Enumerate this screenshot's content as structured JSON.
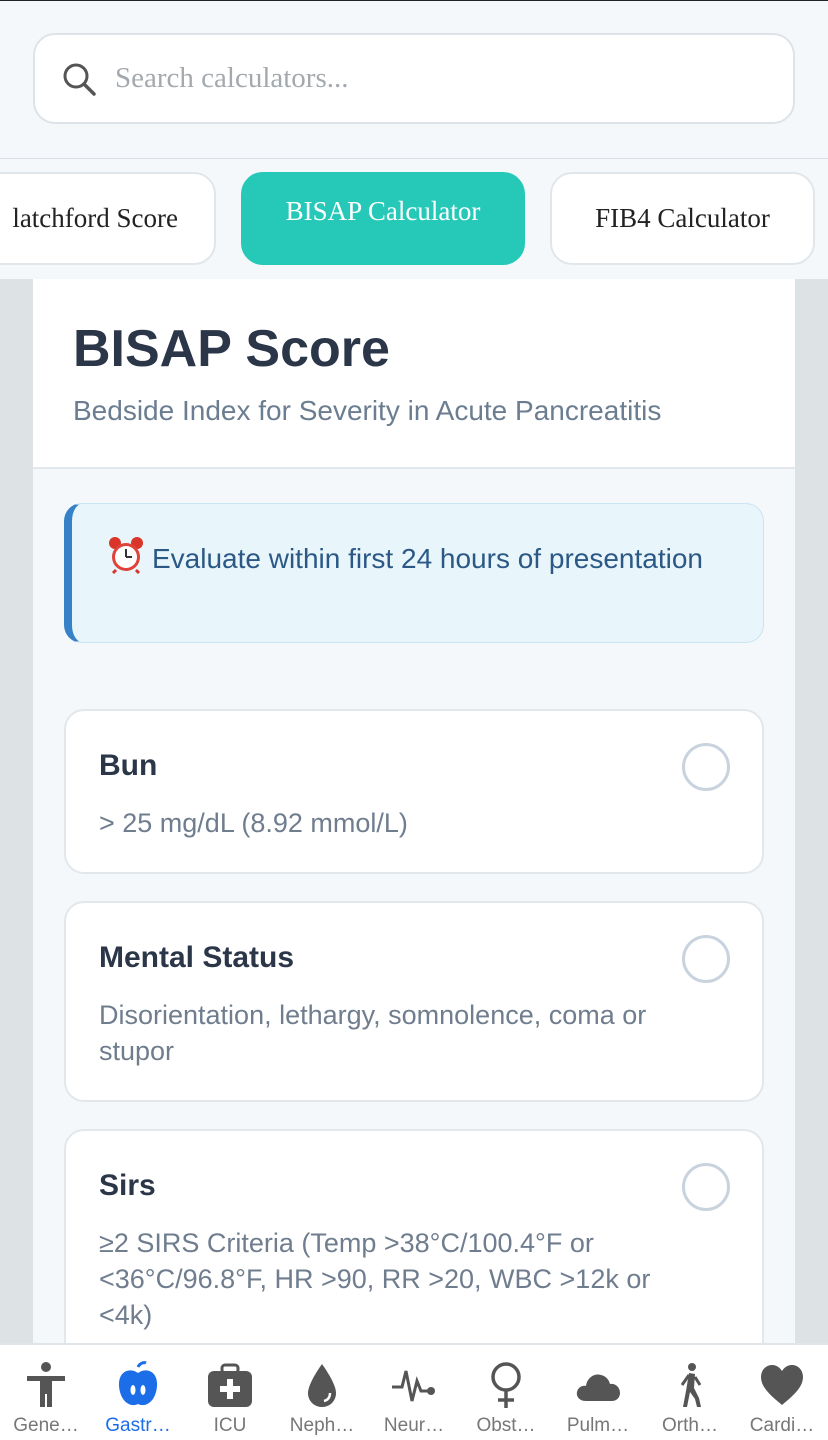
{
  "search": {
    "placeholder": "Search calculators..."
  },
  "calculator_tabs": [
    {
      "label": "Glatchford Score",
      "visible_label": "latchford Score",
      "active": false
    },
    {
      "label": "BISAP Calculator",
      "active": true
    },
    {
      "label": "FIB4 Calculator",
      "active": false
    }
  ],
  "calculator": {
    "title": "BISAP Score",
    "subtitle": "Bedside Index for Severity in Acute Pancreatitis",
    "notice": "Evaluate within first 24 hours of presentation",
    "criteria": [
      {
        "label": "Bun",
        "description": "> 25 mg/dL (8.92 mmol/L)",
        "checked": false
      },
      {
        "label": "Mental Status",
        "description": "Disorientation, lethargy, somnolence, coma or stupor",
        "checked": false
      },
      {
        "label": "Sirs",
        "description": "≥2 SIRS Criteria (Temp >38°C/100.4°F or <36°C/96.8°F, HR >90, RR >20, WBC >12k or <4k)",
        "checked": false
      }
    ]
  },
  "bottom_nav": [
    {
      "label": "Gene…",
      "icon": "person-icon",
      "active": false
    },
    {
      "label": "Gastr…",
      "icon": "stomach-icon",
      "active": true
    },
    {
      "label": "ICU",
      "icon": "medkit-icon",
      "active": false
    },
    {
      "label": "Neph…",
      "icon": "drop-icon",
      "active": false
    },
    {
      "label": "Neur…",
      "icon": "pulse-icon",
      "active": false
    },
    {
      "label": "Obst…",
      "icon": "female-icon",
      "active": false
    },
    {
      "label": "Pulm…",
      "icon": "cloud-icon",
      "active": false
    },
    {
      "label": "Orth…",
      "icon": "walking-icon",
      "active": false
    },
    {
      "label": "Cardi…",
      "icon": "heart-icon",
      "active": false
    }
  ],
  "colors": {
    "accent": "#26c9b8",
    "nav_active": "#1c6ee8",
    "notice_border": "#3582c9"
  }
}
